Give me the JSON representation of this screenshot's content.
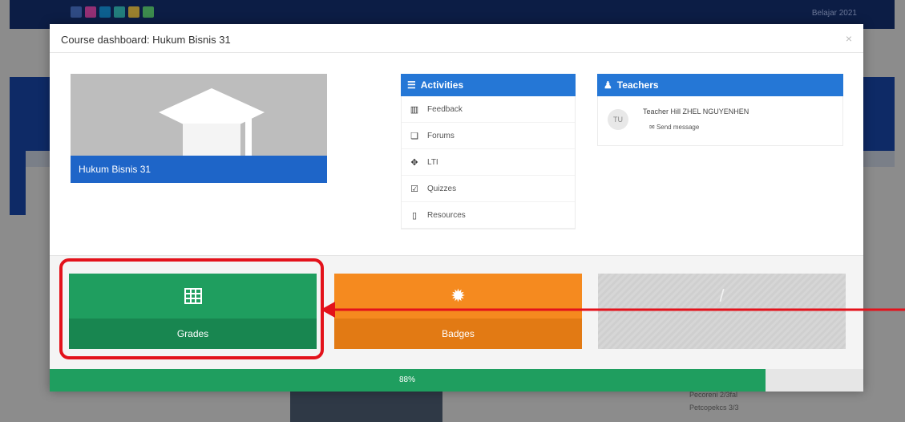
{
  "background": {
    "top_right_text": "Belajar 2021",
    "bottom_lines": [
      "Pecoreni 2/3fal",
      "Petcopekcs 3/3"
    ]
  },
  "modal": {
    "title": "Course dashboard: Hukum Bisnis 31",
    "close_label": "×",
    "course_name": "Hukum Bisnis 31",
    "activities": {
      "heading": "Activities",
      "items": [
        {
          "icon": "chart-icon",
          "label": "Feedback"
        },
        {
          "icon": "forum-icon",
          "label": "Forums"
        },
        {
          "icon": "lti-icon",
          "label": "LTI"
        },
        {
          "icon": "quiz-icon",
          "label": "Quizzes"
        },
        {
          "icon": "file-icon",
          "label": "Resources"
        }
      ]
    },
    "teachers": {
      "heading": "Teachers",
      "teacher_initials": "TU",
      "teacher_name": "Teacher Hill ZHEL NGUYENHEN",
      "message_label": "Send message"
    },
    "tiles": [
      {
        "label": "Grades",
        "color": "#1f9e5f"
      },
      {
        "label": "Badges",
        "color": "#f58a1f"
      },
      {
        "label": "",
        "color": "#d6d6d6"
      }
    ],
    "progress": {
      "value_label": "88%",
      "fraction": 0.88,
      "color": "#1f9e5f"
    }
  },
  "annotation": {
    "color": "#e3121b"
  }
}
